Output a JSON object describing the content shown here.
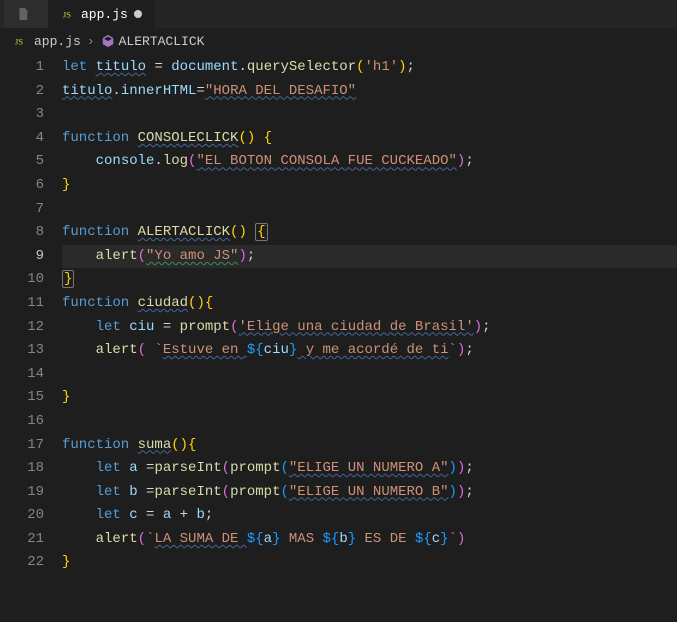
{
  "tabs": {
    "inactive": {
      "label": ""
    },
    "active": {
      "label": "app.js"
    }
  },
  "breadcrumb": {
    "file": "app.js",
    "symbol": "ALERTACLICK"
  },
  "currentLine": 9,
  "code": {
    "l1": {
      "let": "let",
      "titulo": "titulo",
      "eq": " = ",
      "doc": "document",
      "dot": ".",
      "qs": "querySelector",
      "open": "(",
      "str": "'h1'",
      "close": ")",
      "semi": ";"
    },
    "l2": {
      "titulo": "titulo",
      "dot": ".",
      "inner": "innerHTML",
      "eq": "=",
      "str": "\"HORA DEL DESAFIO\""
    },
    "l4": {
      "fn": "function",
      "name": "CONSOLECLICK",
      "parens": "()",
      "sp": " ",
      "brace": "{"
    },
    "l5": {
      "console": "console",
      "dot": ".",
      "log": "log",
      "open": "(",
      "str": "\"EL BOTON CONSOLA FUE CUCKEADO\"",
      "close": ")",
      "semi": ";"
    },
    "l6": {
      "brace": "}"
    },
    "l8": {
      "fn": "function",
      "name": "ALERTACLICK",
      "parens": "()",
      "sp": " ",
      "brace": "{"
    },
    "l9": {
      "alert": "alert",
      "open": "(",
      "str": "\"Yo amo JS\"",
      "close": ")",
      "semi": ";"
    },
    "l10": {
      "brace": "}"
    },
    "l11": {
      "fn": "function",
      "name": "ciudad",
      "parens": "()",
      "brace": "{"
    },
    "l12": {
      "let": "let",
      "ciu": "ciu",
      "eq": " = ",
      "prompt": "prompt",
      "open": "(",
      "str": "'Elige una ciudad de Brasil'",
      "close": ")",
      "semi": ";"
    },
    "l13": {
      "alert": "alert",
      "open": "( ",
      "bt1": "`",
      "s1": "Estuve en ",
      "d1": "${",
      "v1": "ciu",
      "d2": "}",
      "s2": " y me acordé de ti",
      "bt2": "`",
      "close": ")",
      "semi": ";"
    },
    "l15": {
      "brace": "}"
    },
    "l17": {
      "fn": "function",
      "name": "suma",
      "parens": "()",
      "brace": "{"
    },
    "l18": {
      "let": "let",
      "a": "a",
      "eq": " =",
      "pi": "parseInt",
      "open": "(",
      "prompt": "prompt",
      "open2": "(",
      "str": "\"ELIGE UN NUMERO A\"",
      "close2": ")",
      "close": ")",
      "semi": ";"
    },
    "l19": {
      "let": "let",
      "b": "b",
      "eq": " =",
      "pi": "parseInt",
      "open": "(",
      "prompt": "prompt",
      "open2": "(",
      "str": "\"ELIGE UN NUMERO B\"",
      "close2": ")",
      "close": ")",
      "semi": ";"
    },
    "l20": {
      "let": "let",
      "c": "c",
      "eq": " = ",
      "a": "a",
      "plus": " + ",
      "b": "b",
      "semi": ";"
    },
    "l21": {
      "alert": "alert",
      "open": "(",
      "bt1": "`",
      "s1": "LA SUMA DE ",
      "d1": "${",
      "v1": "a",
      "d2": "}",
      "s2": " MAS ",
      "d3": "${",
      "v2": "b",
      "d4": "}",
      "s3": " ES DE ",
      "d5": "${",
      "v3": "c",
      "d6": "}",
      "bt2": "`",
      "close": ")"
    },
    "l22": {
      "brace": "}"
    }
  }
}
